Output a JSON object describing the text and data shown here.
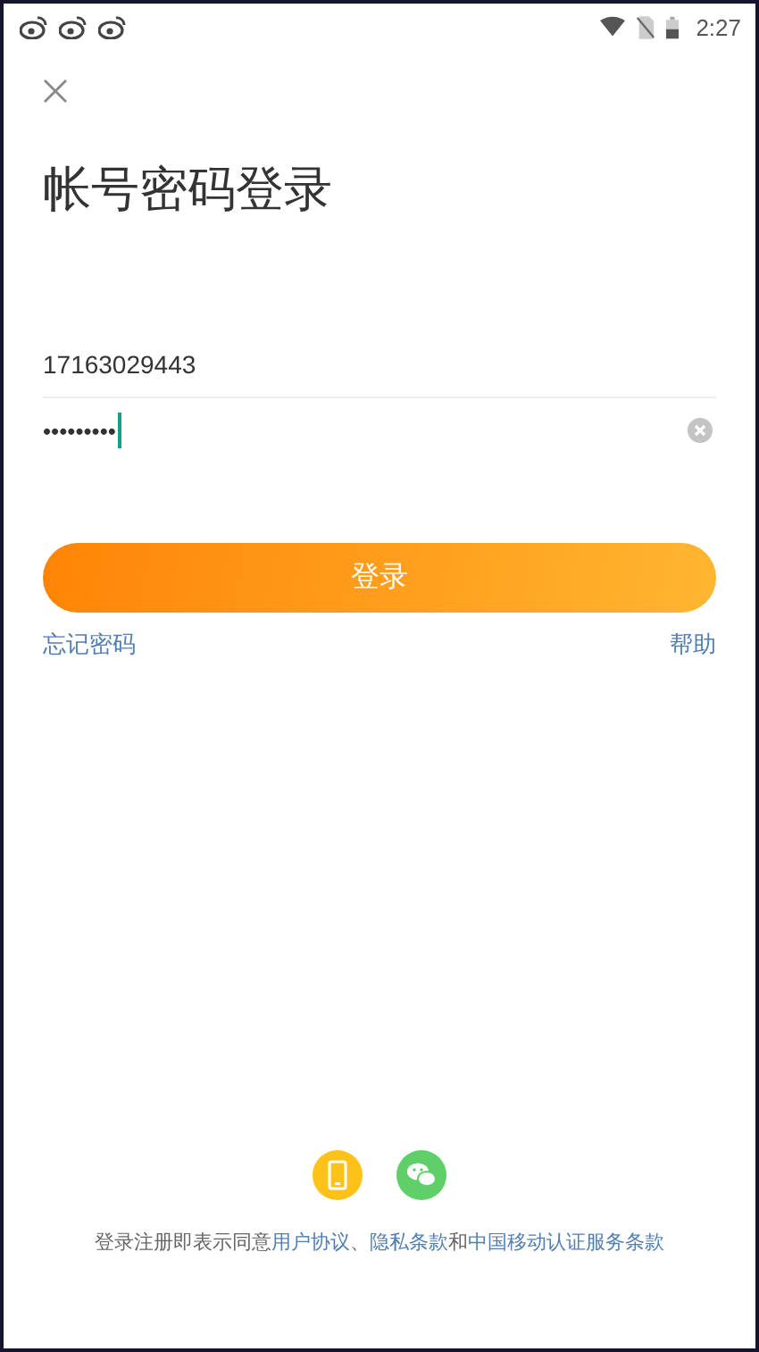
{
  "status_bar": {
    "time": "2:27"
  },
  "title": "帐号密码登录",
  "phone_field": {
    "value": "17163029443"
  },
  "password_field": {
    "value": "•••••••••",
    "focused": true
  },
  "login_button": "登录",
  "forgot_link": "忘记密码",
  "help_link": "帮助",
  "terms": [
    {
      "kind": "text",
      "text": "登录注册即表示同意"
    },
    {
      "kind": "link",
      "text": "用户协议"
    },
    {
      "kind": "text",
      "text": "、"
    },
    {
      "kind": "link",
      "text": "隐私条款"
    },
    {
      "kind": "text",
      "text": "和"
    },
    {
      "kind": "link",
      "text": "中国移动认证服务条款"
    }
  ]
}
